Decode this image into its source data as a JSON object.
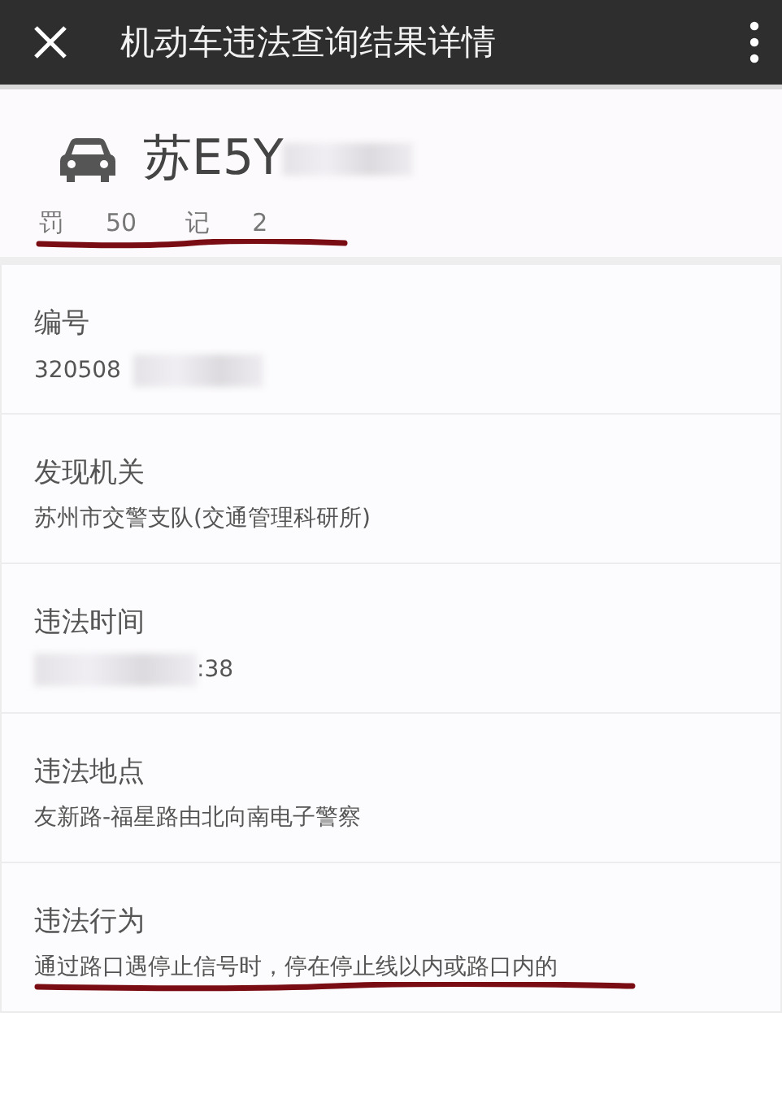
{
  "top_bar": {
    "title": "机动车违法查询结果详情"
  },
  "vehicle": {
    "plate": "苏E5Y",
    "plate_redacted": true,
    "underlined": true,
    "penalties": [
      {
        "label": "罚",
        "value": "50"
      },
      {
        "label": "记",
        "value": "2"
      }
    ]
  },
  "details": [
    {
      "label": "编号",
      "value": "320508",
      "redacted_before": false,
      "redacted_after": true,
      "underlined": false
    },
    {
      "label": "发现机关",
      "value": "苏州市交警支队(交通管理科研所)",
      "redacted_before": false,
      "redacted_after": false,
      "underlined": false
    },
    {
      "label": "违法时间",
      "value": ":38",
      "redacted_before": true,
      "redacted_after": false,
      "underlined": false
    },
    {
      "label": "违法地点",
      "value": "友新路-福星路由北向南电子警察",
      "redacted_before": false,
      "redacted_after": false,
      "underlined": false
    },
    {
      "label": "违法行为",
      "value": "通过路口遇停止信号时，停在停止线以内或路口内的",
      "redacted_before": false,
      "redacted_after": false,
      "underlined": true
    }
  ]
}
